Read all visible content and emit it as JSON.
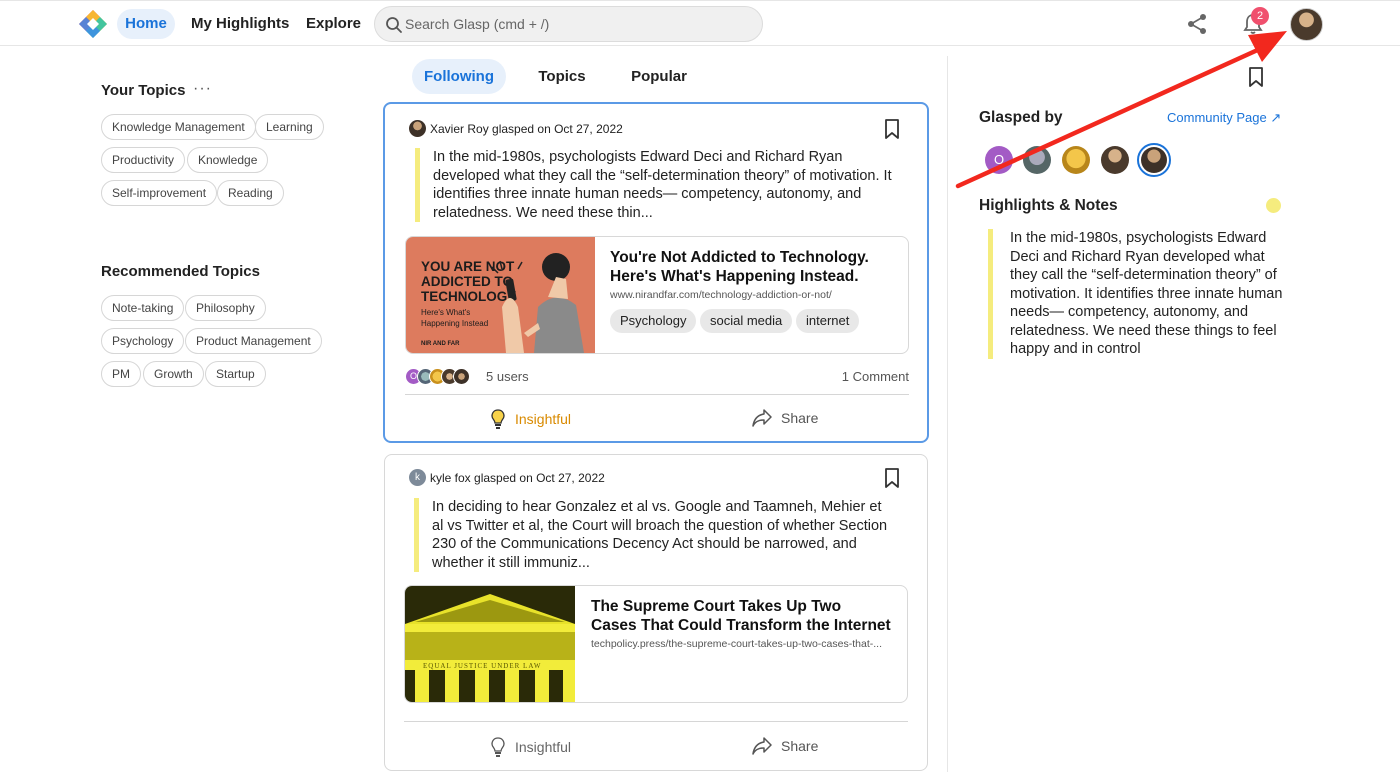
{
  "header": {
    "nav": {
      "home": "Home",
      "highlights": "My Highlights",
      "explore": "Explore"
    },
    "search_placeholder": "Search Glasp (cmd + /)",
    "notification_count": "2"
  },
  "sidebar": {
    "your_topics_title": "Your Topics",
    "more_label": "···",
    "your_topics": [
      "Knowledge Management",
      "Learning",
      "Productivity",
      "Knowledge",
      "Self-improvement",
      "Reading"
    ],
    "recommended_title": "Recommended Topics",
    "recommended": [
      "Note-taking",
      "Philosophy",
      "Psychology",
      "Product Management",
      "PM",
      "Growth",
      "Startup"
    ]
  },
  "tabs": [
    "Following",
    "Topics",
    "Popular"
  ],
  "feed": [
    {
      "user": "Xavier Roy",
      "meta": "glasped on Oct 27, 2022",
      "quote": "In the mid-1980s, psychologists Edward Deci and Richard Ryan developed what they call the “self-determination theory” of motivation. It identifies three innate human needs— competency, autonomy, and relatedness. We need these thin...",
      "thumb_text": {
        "line1": "YOU ARE NOT",
        "line2": "ADDICTED TO",
        "line3": "TECHNOLOGY",
        "sub1": "Here's What's",
        "sub2": "Happening Instead",
        "brand": "NIR AND FAR"
      },
      "link_title": "You're Not Addicted to Technology. Here's What's Happening Instead.",
      "link_url": "www.nirandfar.com/technology-addiction-or-not/",
      "tags": [
        "Psychology",
        "social media",
        "internet"
      ],
      "users_avatar_letter": "O",
      "users": "5 users",
      "comments": "1 Comment",
      "insightful": "Insightful",
      "share": "Share"
    },
    {
      "user": "kyle fox",
      "avatar_letter": "k",
      "meta": "glasped on Oct 27, 2022",
      "quote": "In deciding to hear Gonzalez et al vs. Google and Taamneh, Mehier et al vs Twitter et al, the Court will broach the question of whether Section 230 of the Communications Decency Act should be narrowed, and whether it still immuniz...",
      "thumb_text": "EQUAL JUSTICE UNDER LAW",
      "link_title": "The Supreme Court Takes Up Two Cases That Could Transform the Internet",
      "link_url": "techpolicy.press/the-supreme-court-takes-up-two-cases-that-...",
      "insightful": "Insightful",
      "share": "Share"
    }
  ],
  "right_panel": {
    "glasped_by": "Glasped by",
    "community_link": "Community Page ↗",
    "first_avatar_letter": "O",
    "highlights_title": "Highlights & Notes",
    "highlight": "In the mid-1980s, psychologists Edward Deci and Richard Ryan developed what they call the “self-determination theory” of motivation. It identifies three innate human needs— competency, autonomy, and relatedness. We need these things to feel happy and in control"
  },
  "colors": {
    "accent": "#1a73d9",
    "highlight": "#f5ec7e",
    "insightful": "#d98a00",
    "annotation_arrow": "#f2281e"
  }
}
